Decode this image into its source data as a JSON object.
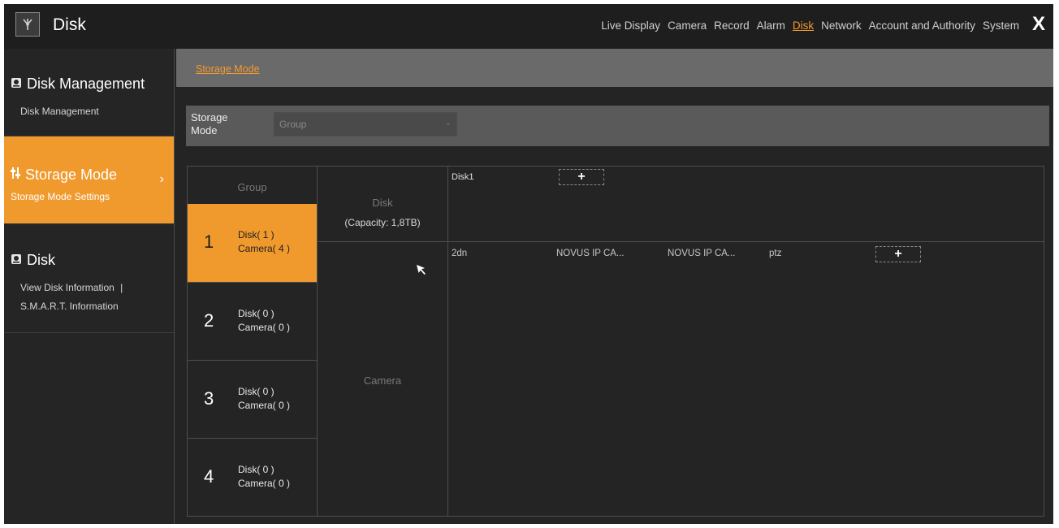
{
  "header": {
    "title": "Disk",
    "nav": [
      "Live Display",
      "Camera",
      "Record",
      "Alarm",
      "Disk",
      "Network",
      "Account and Authority",
      "System"
    ],
    "active_nav": "Disk",
    "close_glyph": "X"
  },
  "sidebar": {
    "sections": [
      {
        "title": "Disk Management",
        "icon": "disk-icon",
        "subs": [
          "Disk Management"
        ]
      },
      {
        "title": "Storage Mode",
        "icon": "sliders-icon",
        "subs": [
          "Storage Mode Settings"
        ]
      },
      {
        "title": "Disk",
        "icon": "disk-icon",
        "subs": [
          "View Disk Information",
          "|",
          "S.M.A.R.T. Information"
        ]
      }
    ],
    "chevron": "›"
  },
  "tabs": [
    "Storage Mode"
  ],
  "storage_mode": {
    "label_line1": "Storage",
    "label_line2": "Mode",
    "value": "Group",
    "chevron": "⌄"
  },
  "group_table": {
    "header": "Group",
    "rows": [
      {
        "num": "1",
        "disk": "Disk( 1 )",
        "camera": "Camera( 4 )",
        "selected": true
      },
      {
        "num": "2",
        "disk": "Disk( 0 )",
        "camera": "Camera( 0 )",
        "selected": false
      },
      {
        "num": "3",
        "disk": "Disk( 0 )",
        "camera": "Camera( 0 )",
        "selected": false
      },
      {
        "num": "4",
        "disk": "Disk( 0 )",
        "camera": "Camera( 0 )",
        "selected": false
      }
    ]
  },
  "detail": {
    "disk_label": "Disk",
    "capacity": "(Capacity: 1,8TB)",
    "camera_label": "Camera",
    "disks": [
      "Disk1"
    ],
    "cameras": [
      "2dn",
      "NOVUS IP CA...",
      "NOVUS IP CA...",
      "ptz"
    ],
    "add_glyph": "+"
  },
  "colors": {
    "accent": "#f09a2e",
    "link": "#f39a2c",
    "background": "#242424"
  }
}
